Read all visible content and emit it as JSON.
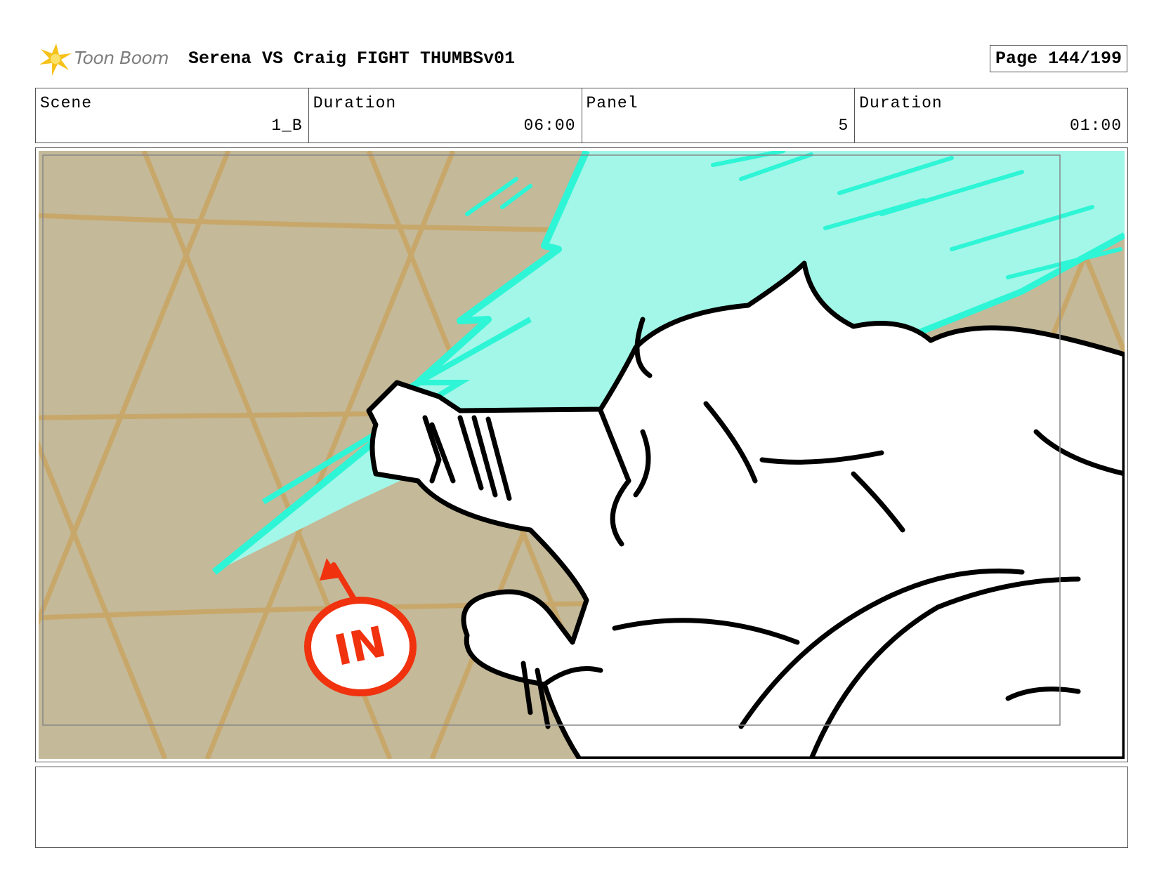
{
  "header": {
    "logo_text": "Toon Boom",
    "title": "Serena VS Craig FIGHT THUMBSv01",
    "page": "Page 144/199"
  },
  "info": {
    "scene_label": "Scene",
    "scene_value": "1_B",
    "duration_label": "Duration",
    "duration_value": "06:00",
    "panel_label": "Panel",
    "panel_value": "5",
    "panel_duration_label": "Duration",
    "panel_duration_value": "01:00"
  },
  "panel": {
    "in_marker_text": "IN",
    "background_color": "#c4b998",
    "grid_color": "#c9a562",
    "energy_color": "#2ef5d6",
    "energy_fill_color": "#a2f7e8",
    "marker_color": "#f0320f"
  },
  "notes": {
    "text": ""
  }
}
